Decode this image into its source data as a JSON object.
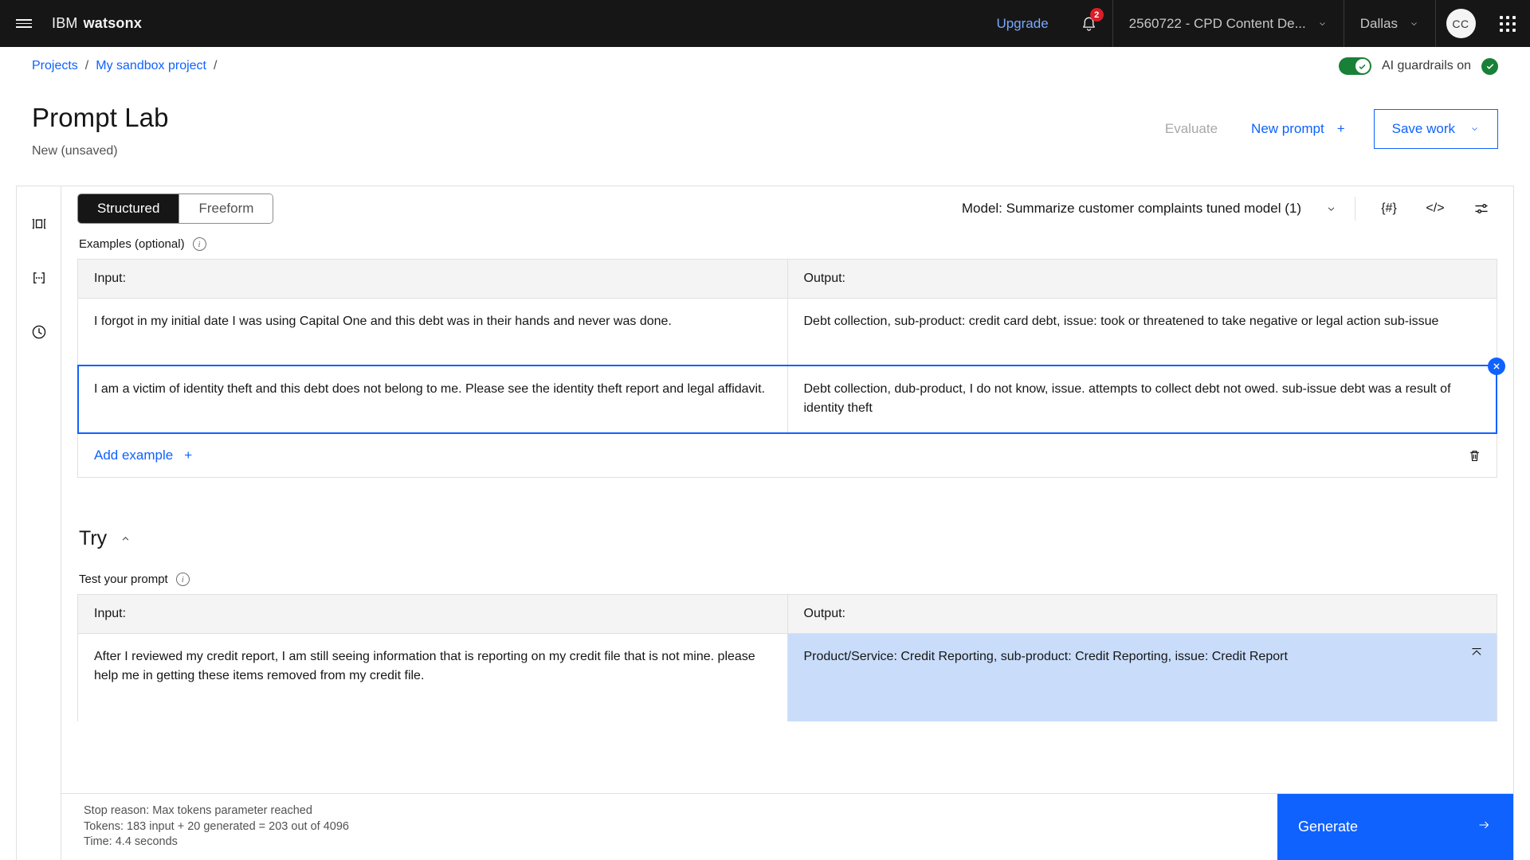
{
  "header": {
    "menu_icon": "hamburger-icon",
    "brand_prefix": "IBM",
    "brand_name": "watsonx",
    "upgrade_label": "Upgrade",
    "notification_count": "2",
    "account_label": "2560722 - CPD Content De...",
    "region_label": "Dallas",
    "avatar_initials": "CC",
    "app_switcher_icon": "grid-icon"
  },
  "breadcrumb": {
    "items": [
      "Projects",
      "My sandbox project"
    ],
    "separator": "/",
    "guardrails_label": "AI guardrails on"
  },
  "page": {
    "title": "Prompt Lab",
    "subtitle": "New (unsaved)",
    "evaluate_label": "Evaluate",
    "new_prompt_label": "New prompt",
    "new_prompt_plus": "+",
    "save_work_label": "Save work"
  },
  "rail": {
    "items": [
      {
        "name": "prompt-variables-icon",
        "glyph": "]▯["
      },
      {
        "name": "prompt-template-icon",
        "glyph": "[...]"
      },
      {
        "name": "history-icon",
        "glyph": "clock"
      }
    ]
  },
  "toolbar": {
    "mode_structured": "Structured",
    "mode_freeform": "Freeform",
    "model_label": "Model: Summarize customer complaints tuned model (1)",
    "icon_variables": "{#}",
    "icon_code": "</>",
    "icon_parameters": "sliders-icon"
  },
  "examples": {
    "section_label": "Examples (optional)",
    "col_input": "Input:",
    "col_output": "Output:",
    "rows": [
      {
        "input": "I forgot in my initial date I was using Capital One and this debt was in their hands and never was done.",
        "output": "Debt collection, sub-product: credit card debt, issue: took or threatened to take negative or legal action sub-issue",
        "selected": false
      },
      {
        "input": "I am a victim of identity theft and this debt does not belong to me. Please see the identity theft report and legal affidavit.",
        "output": "Debt collection, dub-product, I do not know, issue. attempts to collect debt not owed. sub-issue debt was a result of identity theft",
        "selected": true
      }
    ],
    "add_example_label": "Add example",
    "add_example_plus": "+",
    "delete_icon": "trash-icon"
  },
  "try": {
    "title": "Try",
    "section_label": "Test your prompt",
    "col_input": "Input:",
    "col_output": "Output:",
    "input_value": "After I reviewed my credit report, I am still seeing information that is reporting on my credit file that is not mine. please help me in getting these items removed from my credit file.",
    "output_value": "Product/Service: Credit Reporting, sub-product: Credit Reporting, issue: Credit Report"
  },
  "footer": {
    "stop_reason": "Stop reason: Max tokens parameter reached",
    "tokens": "Tokens: 183 input + 20 generated = 203 out of 4096",
    "time": "Time: 4.4 seconds",
    "generate_label": "Generate"
  },
  "colors": {
    "brand_blue": "#0f62fe",
    "link_blue": "#78a9ff",
    "green": "#198038",
    "red": "#da1e28",
    "header_bg": "#161616",
    "selected_output_bg": "#c9ddfb"
  }
}
